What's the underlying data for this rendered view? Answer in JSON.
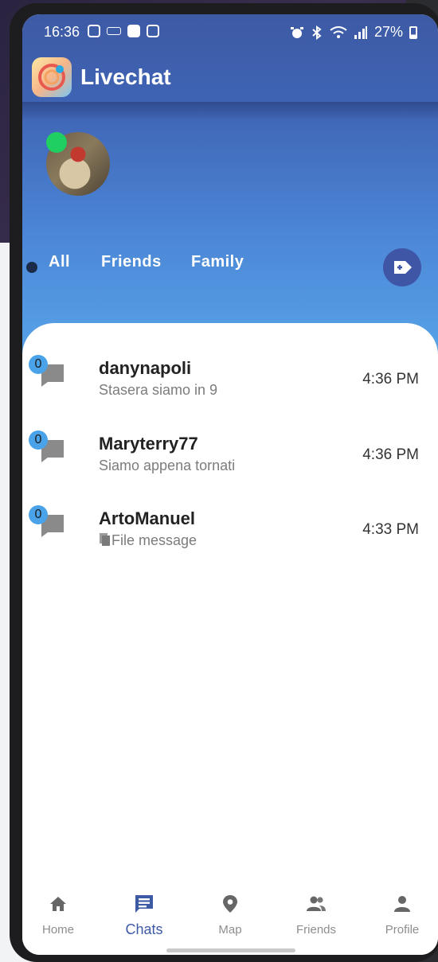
{
  "status_bar": {
    "time": "16:36",
    "battery": "27%"
  },
  "app": {
    "title": "Livechat"
  },
  "colors": {
    "header_top": "#3d5aa4",
    "header_bottom": "#58a9ec",
    "online": "#1fcf62",
    "badge": "#4aa3e8",
    "active_nav": "#3d5aa4"
  },
  "tabs": [
    {
      "label": "All",
      "active": true
    },
    {
      "label": "Friends",
      "active": false
    },
    {
      "label": "Family",
      "active": false
    }
  ],
  "chats": [
    {
      "name": "danynapoli",
      "message": "Stasera siamo in 9",
      "time": "4:36 PM",
      "unread": "0",
      "icon": "chat-bubble-icon"
    },
    {
      "name": "Maryterry77",
      "message": "Siamo appena tornati",
      "time": "4:36 PM",
      "unread": "0",
      "icon": "chat-bubble-icon"
    },
    {
      "name": "ArtoManuel",
      "message": "File message",
      "time": "4:33 PM",
      "unread": "0",
      "icon": "chat-bubble-icon",
      "message_icon": "file-icon"
    }
  ],
  "bottom_nav": [
    {
      "label": "Home",
      "icon": "home-icon",
      "active": false
    },
    {
      "label": "Chats",
      "icon": "chat-icon",
      "active": true
    },
    {
      "label": "Map",
      "icon": "map-pin-icon",
      "active": false
    },
    {
      "label": "Friends",
      "icon": "friends-icon",
      "active": false
    },
    {
      "label": "Profile",
      "icon": "profile-icon",
      "active": false
    }
  ]
}
